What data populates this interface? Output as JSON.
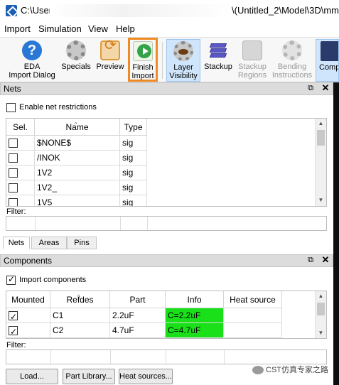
{
  "window": {
    "title_left": "C:\\Users",
    "title_right": "\\(Untitled_2\\Model\\3D\\mm"
  },
  "menu": [
    "Import",
    "Simulation",
    "View",
    "Help"
  ],
  "ribbon": {
    "buttons": [
      {
        "line1": "EDA",
        "line2": "Import Dialog",
        "icon": "help-icon"
      },
      {
        "line1": "Specials",
        "line2": "",
        "icon": "gear-icon"
      },
      {
        "line1": "Preview",
        "line2": "",
        "icon": "preview-icon"
      },
      {
        "line1": "Finish",
        "line2": "Import",
        "icon": "finish-import-icon"
      },
      {
        "line1": "Layer",
        "line2": "Visibility",
        "icon": "eye-icon"
      },
      {
        "line1": "Stackup",
        "line2": "",
        "icon": "stackup-icon"
      },
      {
        "line1": "Stackup",
        "line2": "Regions",
        "icon": "stackup-regions-icon"
      },
      {
        "line1": "Bending",
        "line2": "Instructions",
        "icon": "bending-icon"
      },
      {
        "line1": "Comp",
        "line2": "",
        "icon": "components-icon"
      }
    ],
    "highlight_color": "#f08a24"
  },
  "nets_panel": {
    "title": "Nets",
    "enable_label": "Enable net restrictions",
    "enable_checked": false,
    "columns": [
      "Sel.",
      "Name",
      "Type"
    ],
    "rows": [
      {
        "sel": false,
        "name": "$NONE$",
        "type": "sig"
      },
      {
        "sel": false,
        "name": "/INOK",
        "type": "sig"
      },
      {
        "sel": false,
        "name": "1V2",
        "type": "sig"
      },
      {
        "sel": false,
        "name": "1V2_",
        "type": "sig"
      },
      {
        "sel": false,
        "name": "1V5",
        "type": "sig"
      }
    ],
    "filter_label": "Filter:",
    "tabs": [
      "Nets",
      "Areas",
      "Pins"
    ],
    "active_tab": "Nets"
  },
  "components_panel": {
    "title": "Components",
    "import_label": "Import components",
    "import_checked": true,
    "columns": [
      "Mounted",
      "Refdes",
      "Part",
      "Info",
      "Heat source"
    ],
    "rows": [
      {
        "mounted": true,
        "refdes": "C1",
        "part": "2.2uF",
        "info": "C=2.2uF",
        "heat": ""
      },
      {
        "mounted": true,
        "refdes": "C2",
        "part": "4.7uF",
        "info": "C=4.7uF",
        "heat": ""
      }
    ],
    "info_color": "#19e019",
    "filter_label": "Filter:",
    "buttons": [
      "Load...",
      "Part Library...",
      "Heat sources..."
    ]
  },
  "watermark": "CST仿真专家之路"
}
